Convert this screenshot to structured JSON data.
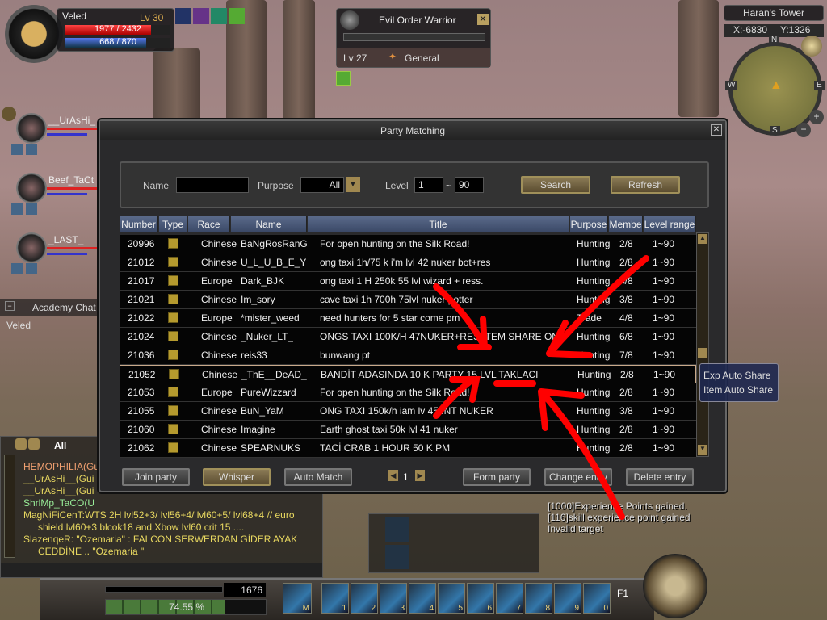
{
  "player": {
    "name": "Veled",
    "level": "Lv 30",
    "hp": "1977 / 2432",
    "mp": "668 / 870",
    "hp_fraction": 0.813,
    "mp_fraction": 0.768
  },
  "target": {
    "name": "Evil Order Warrior",
    "level": "Lv 27",
    "rank": "General"
  },
  "minimap": {
    "location": "Haran's Tower",
    "x": "X:-6830",
    "y": "Y:1326",
    "n": "N",
    "s": "S",
    "e": "E",
    "w": "W"
  },
  "party": [
    {
      "name": "__UrAsHi_"
    },
    {
      "name": "Beef_TaCt"
    },
    {
      "name": "_LAST_"
    }
  ],
  "academy": {
    "title": "Academy Chat",
    "member": "Veled"
  },
  "dialog": {
    "title": "Party Matching",
    "filter": {
      "name_label": "Name",
      "name_value": "",
      "purpose_label": "Purpose",
      "purpose_value": "All",
      "level_label": "Level",
      "level_min": "1",
      "tilde": "~",
      "level_max": "90",
      "search": "Search",
      "refresh": "Refresh"
    },
    "columns": [
      "Number",
      "Type",
      "Race",
      "Name",
      "Title",
      "Purpose",
      "Membe",
      "Level range"
    ],
    "rows": [
      [
        "20996",
        "Chinese",
        "BaNgRosRanG",
        "For open hunting on the Silk Road!",
        "Hunting",
        "2/8",
        "1~90"
      ],
      [
        "21012",
        "Chinese",
        "U_L_U_B_E_Y",
        "ong taxi 1h/75 k i'm  lvl 42 nuker bot+res",
        "Hunting",
        "2/8",
        "1~90"
      ],
      [
        "21017",
        "Europe",
        "Dark_BJK",
        "ong taxi 1 H 250k 55 lvl wizard + ress.",
        "Hunting",
        "4/8",
        "1~90"
      ],
      [
        "21021",
        "Chinese",
        "Im_sory",
        "cave taxi 1h 700h 75lvl nuker potter",
        "Hunting",
        "3/8",
        "1~90"
      ],
      [
        "21022",
        "Europe",
        "*mister_weed",
        "need hunters for 5 star come pm",
        "Trade",
        "4/8",
        "1~90"
      ],
      [
        "21024",
        "Chinese",
        "_Nuker_LT_",
        "ONGS TAXI 100K/H 47NUKER+RES ITEM SHARE ON",
        "Hunting",
        "6/8",
        "1~90"
      ],
      [
        "21036",
        "Chinese",
        "reis33",
        "bunwang pt",
        "Hunting",
        "7/8",
        "1~90"
      ],
      [
        "21052",
        "Chinese",
        "_ThE__DeAD_",
        "BANDİT ADASINDA 10 K PARTY 15 LVL TAKLACI",
        "Hunting",
        "2/8",
        "1~90"
      ],
      [
        "21053",
        "Europe",
        "PureWizzard",
        "For open hunting on the Silk Road!",
        "Hunting",
        "2/8",
        "1~90"
      ],
      [
        "21055",
        "Chinese",
        "BuN_YaM",
        "ONG TAXI 150k/h iam lv 45 INT NUKER",
        "Hunting",
        "3/8",
        "1~90"
      ],
      [
        "21060",
        "Chinese",
        "Imagine",
        "Earth ghost taxi 50k lvl 41 nuker",
        "Hunting",
        "2/8",
        "1~90"
      ],
      [
        "21062",
        "Chinese",
        "SPEARNUKS",
        "TACİ CRAB 1 HOUR 50 K PM",
        "Hunting",
        "2/8",
        "1~90"
      ]
    ],
    "selected_row": 7,
    "buttons": {
      "join": "Join party",
      "whisper": "Whisper",
      "auto": "Auto Match",
      "form": "Form party",
      "change": "Change entry",
      "delete": "Delete entry"
    },
    "page": "1"
  },
  "tooltip": {
    "line1": "Exp Auto Share",
    "line2": "Item Auto Share"
  },
  "chat": {
    "tab": "All",
    "lines": [
      "HEMOPHILIA(Gui",
      "__UrAsHi__(Gui",
      "__UrAsHi__(Gui",
      "ShrlMp_TaCO(U",
      "MagNiFiCenT:WTS 2H lvl52+3/ lvl56+4/ lvl60+5/ lvl68+4 // euro",
      "shield lvl60+3 blcok18 and Xbow lvl60 crit 15 ....",
      "SlazenqeR:   \"Ozemaria\" : FALCON SERWERDAN GİDER AYAK",
      "CEDDİNE         .. \"Ozemaria \""
    ]
  },
  "system_log": [
    "[1000]Experience Points gained.",
    "[116]skill experience point gained",
    "Invalid target"
  ],
  "exp": {
    "sp": "1676",
    "percent": "74.55 %",
    "fraction": 0.7455
  },
  "hotbar": {
    "slots": [
      "1",
      "2",
      "3",
      "4",
      "5",
      "6",
      "7",
      "8",
      "9",
      "0"
    ],
    "page": "F1",
    "mount_key": "M"
  },
  "colors": {
    "hp": "#d01818",
    "mp": "#2a4cc0",
    "annotation": "#ff0000",
    "header": "#4a5a7a"
  }
}
